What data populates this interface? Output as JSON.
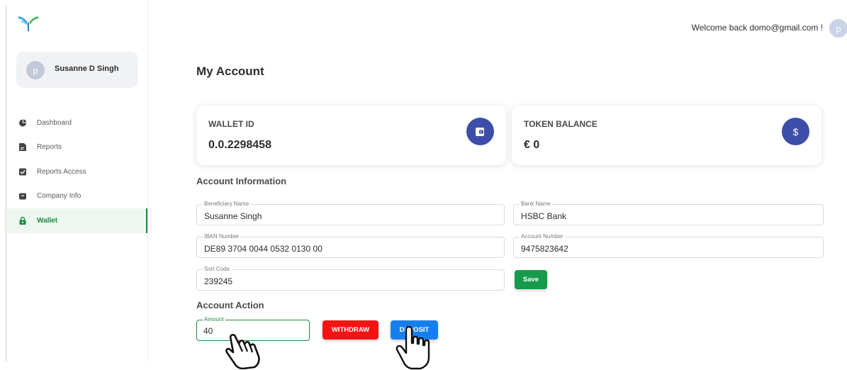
{
  "sidebar": {
    "profile": {
      "avatar_letter": "p",
      "name": "Susanne D Singh"
    },
    "items": [
      {
        "label": "Dashboard",
        "icon": "pie-chart-icon",
        "active": false
      },
      {
        "label": "Reports",
        "icon": "document-icon",
        "active": false
      },
      {
        "label": "Reports Access",
        "icon": "checkbox-icon",
        "active": false
      },
      {
        "label": "Company Info",
        "icon": "briefcase-icon",
        "active": false
      },
      {
        "label": "Wallet",
        "icon": "lock-icon",
        "active": true
      }
    ]
  },
  "header": {
    "welcome": "Welcome back domo@gmail.com !",
    "avatar_letter": "p"
  },
  "page": {
    "title": "My Account"
  },
  "wallet_card": {
    "label": "WALLET ID",
    "value": "0.0.2298458",
    "icon": "wallet-icon"
  },
  "token_card": {
    "label": "TOKEN BALANCE",
    "value": "€ 0",
    "icon": "dollar-icon",
    "icon_glyph": "$"
  },
  "account_info": {
    "title": "Account Information",
    "beneficiary_name": {
      "label": "Beneficiary Name",
      "value": "Susanne Singh"
    },
    "bank_name": {
      "label": "Bank Name",
      "value": "HSBC Bank"
    },
    "iban": {
      "label": "IBAN Number",
      "value": "DE89 3704 0044 0532 0130 00"
    },
    "account_number": {
      "label": "Account Number",
      "value": "9475823642"
    },
    "sort_code": {
      "label": "Sort Code",
      "value": "239245"
    },
    "save_label": "Save"
  },
  "account_action": {
    "title": "Account Action",
    "amount": {
      "label": "Amount",
      "value": "40"
    },
    "withdraw_label": "WITHDRAW",
    "deposit_label": "DEPOSIT"
  },
  "colors": {
    "accent_green": "#1e8a3c",
    "icon_blue": "#3d4ea8",
    "withdraw_red": "#f41313",
    "deposit_blue": "#167ff0"
  }
}
